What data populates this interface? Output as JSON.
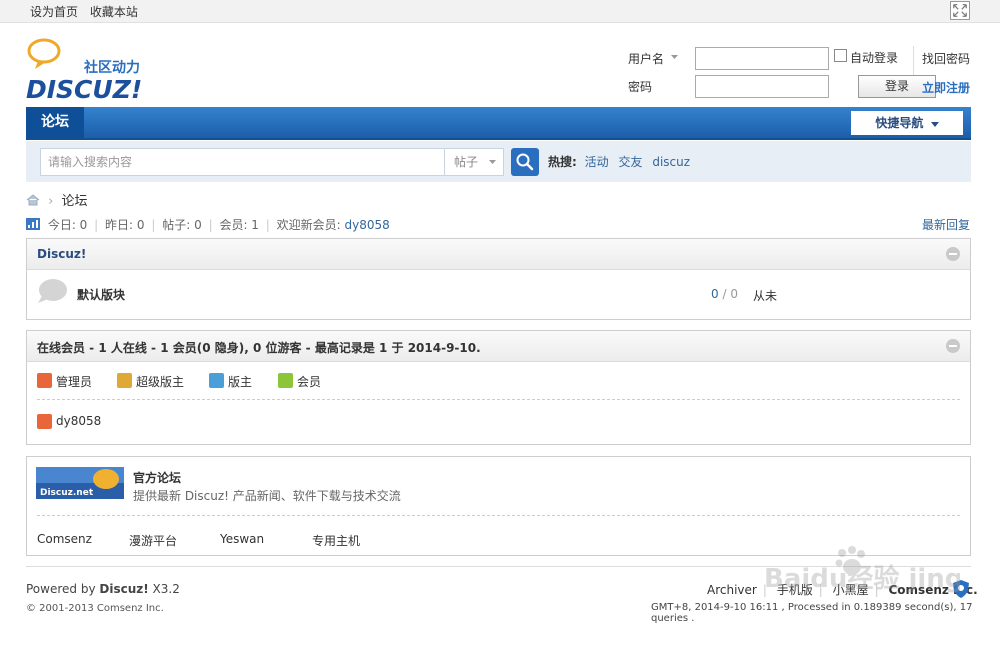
{
  "topbar": {
    "set_home": "设为首页",
    "bookmark": "收藏本站"
  },
  "logo": {
    "slogan": "社区动力",
    "brand": "DISCUZ!"
  },
  "login": {
    "username_label": "用户名",
    "password_label": "密码",
    "remember_label": "自动登录",
    "login_button": "登录",
    "forgot_link": "找回密码",
    "register_link": "立即注册"
  },
  "nav": {
    "active_tab": "论坛",
    "quick_nav": "快捷导航"
  },
  "search": {
    "placeholder": "请输入搜索内容",
    "type": "帖子",
    "hot_label": "热搜:",
    "hot_terms": [
      "活动",
      "交友",
      "discuz"
    ]
  },
  "breadcrumb": {
    "current": "论坛"
  },
  "stats": {
    "today": "今日: 0",
    "yesterday": "昨日: 0",
    "posts": "帖子: 0",
    "members": "会员: 1",
    "welcome_label": "欢迎新会员:",
    "new_member": "dy8058",
    "latest_reply": "最新回复"
  },
  "category": {
    "title": "Discuz!",
    "forum": {
      "name": "默认版块",
      "threads": "0",
      "sep": " / ",
      "posts": "0",
      "last_post": "从未"
    }
  },
  "online": {
    "title": "在线会员 - 1 人在线 - 1 会员(0 隐身), 0 位游客 - 最高记录是 1 于 2014-9-10.",
    "legend": [
      "管理员",
      "超级版主",
      "版主",
      "会员"
    ],
    "user": "dy8058"
  },
  "official": {
    "logo_text": "Discuz.net",
    "title": "官方论坛",
    "description": "提供最新 Discuz! 产品新闻、软件下载与技术交流",
    "partners": [
      "Comsenz",
      "漫游平台",
      "Yeswan",
      "专用主机"
    ]
  },
  "footer": {
    "powered_prefix": "Powered by ",
    "powered_brand": "Discuz!",
    "version": " X3.2",
    "copyright": "© 2001-2013 Comsenz Inc.",
    "links": [
      "Archiver",
      "手机版",
      "小黑屋",
      "Comsenz Inc."
    ],
    "gmt": "GMT+8, 2014-9-10 16:11 , Processed in 0.189389 second(s), 17 queries ."
  },
  "colors": {
    "nav_blue": "#1b5ea9",
    "link_blue": "#336699",
    "admin": "#e8663a",
    "super_mod": "#e0a834",
    "mod": "#4a9fd8",
    "member": "#8cc43a"
  },
  "watermark": "Baidu经验 jingyan.baidu.com"
}
